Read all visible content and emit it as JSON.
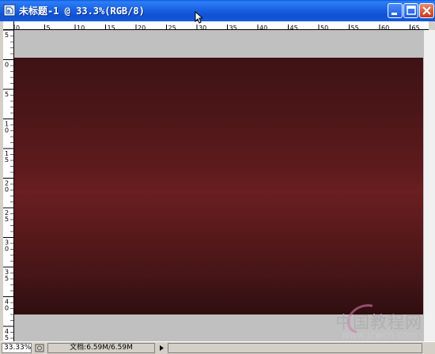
{
  "window": {
    "title": "未标题-1 @ 33.3%(RGB/8)"
  },
  "title_buttons": {
    "minimize": "minimize-icon",
    "maximize": "maximize-icon",
    "close": "close-icon"
  },
  "ruler": {
    "top_labels": [
      "0",
      "5",
      "10",
      "15",
      "20",
      "25",
      "30",
      "35",
      "40",
      "45",
      "50",
      "55",
      "60",
      "65"
    ],
    "left_labels": [
      "5",
      "0",
      "5",
      "10",
      "15",
      "20",
      "25",
      "30",
      "35",
      "40",
      "45"
    ]
  },
  "canvas": {
    "fill_top": "#3e1214",
    "fill_mid": "#6a1f21",
    "fill_bottom": "#2f0e10",
    "pasteboard": "#c0c0c0"
  },
  "statusbar": {
    "zoom": "33.33%",
    "doc_info": "文档:6.59M/6.59M"
  },
  "watermark": {
    "title": "中国教程网",
    "url": "www.jcwcn.com"
  }
}
